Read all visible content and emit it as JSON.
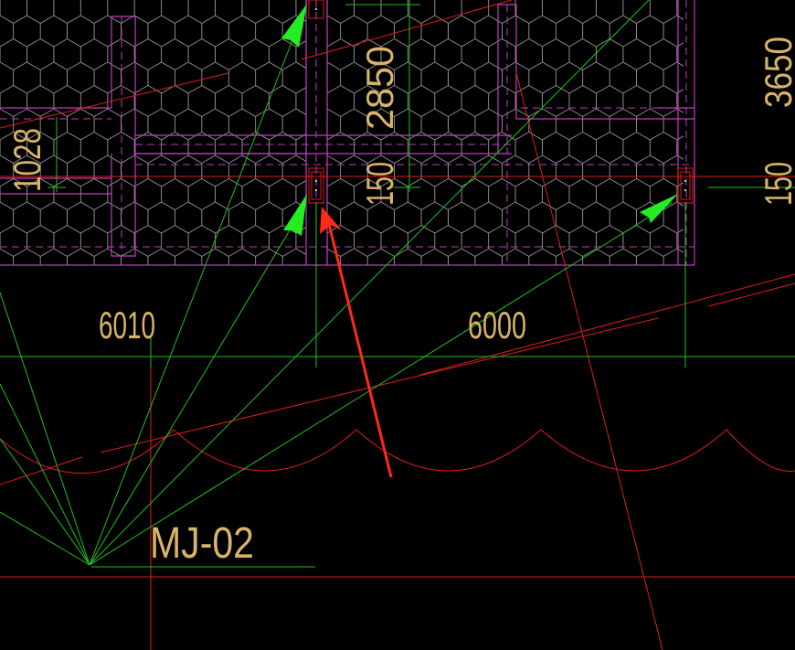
{
  "drawing": {
    "background_color": "#000000",
    "colors": {
      "wall": "#c03cc0",
      "hatch": "#a0a0a0",
      "grid_line": "#e01c1c",
      "dimension": "#20c020",
      "text": "#d8b469",
      "arrow_red": "#ff2a1a",
      "arrow_green": "#22ee22"
    },
    "dimensions": {
      "span_left": "6010",
      "span_right": "6000",
      "height_mid": "2850",
      "height_right": "3650",
      "offset_mid": "150",
      "offset_right": "150",
      "left_partial": "1028"
    },
    "label": "MJ-02",
    "icons": [
      "red-pointer-arrow-icon",
      "green-pointer-arrow-icon"
    ]
  }
}
